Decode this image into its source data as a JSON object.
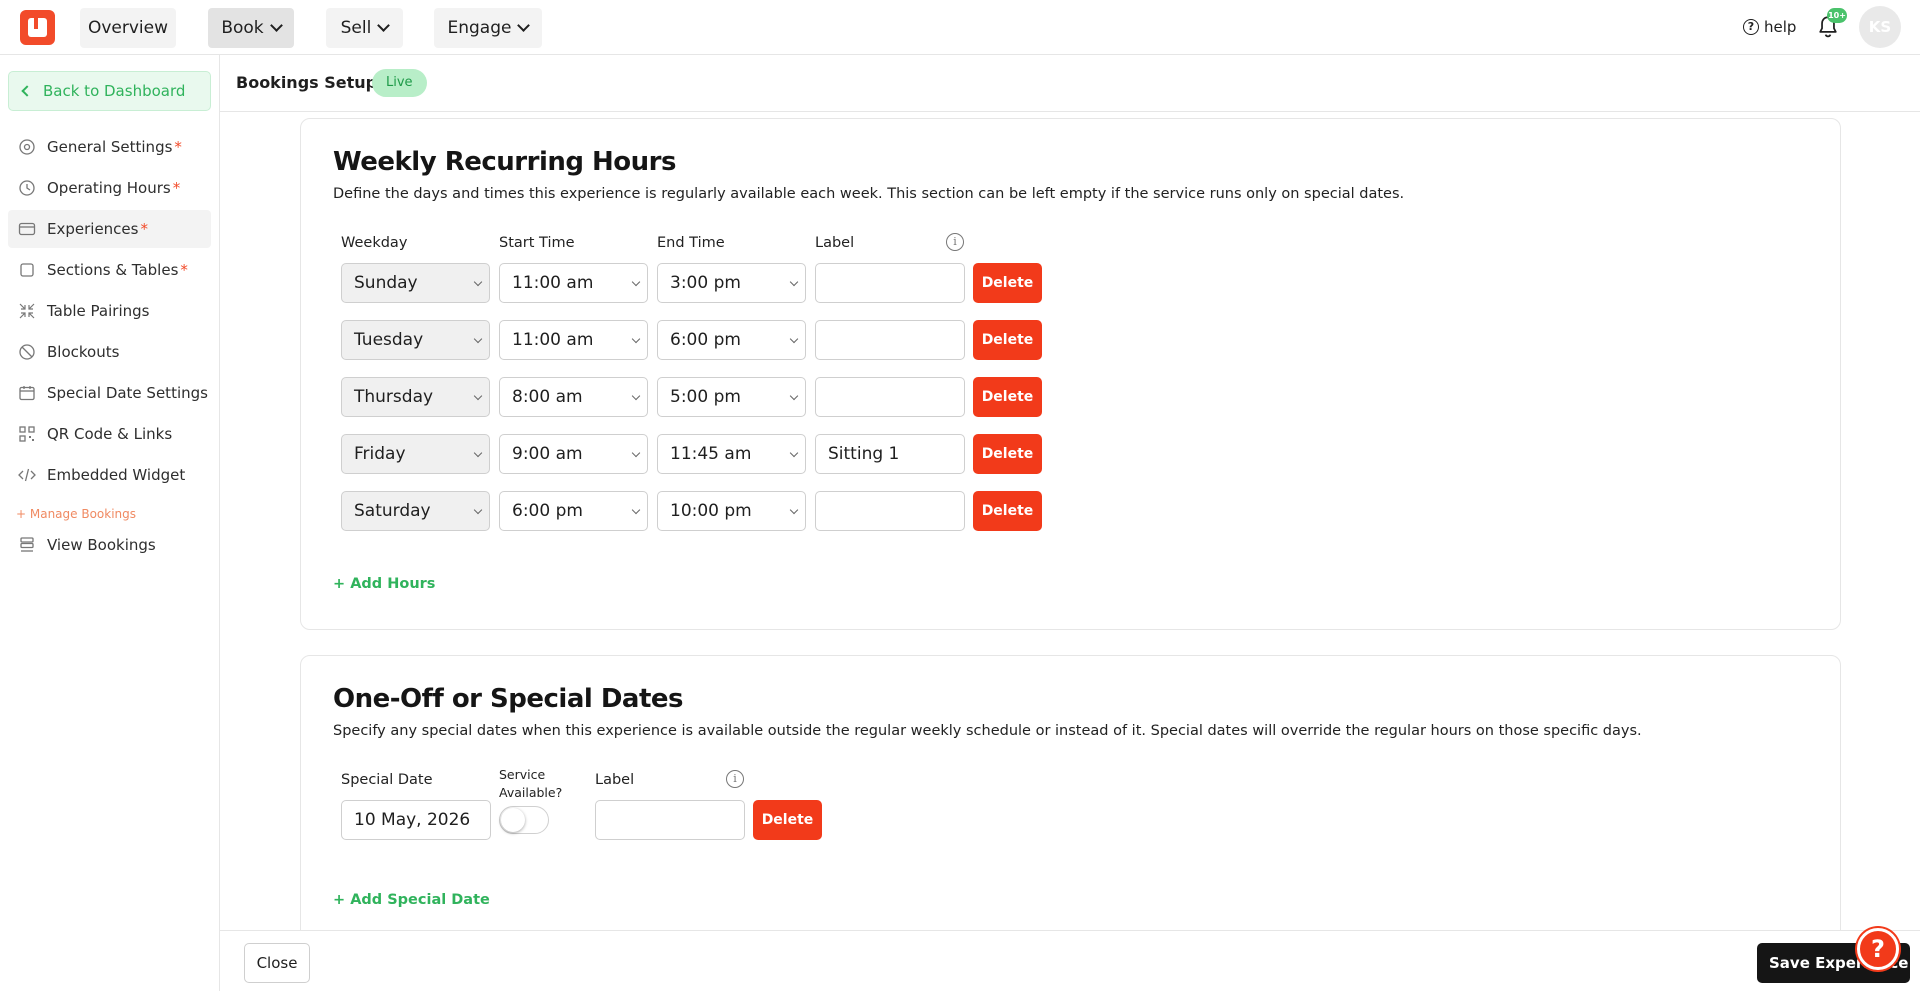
{
  "topnav": {
    "items": [
      {
        "label": "Overview"
      },
      {
        "label": "Book"
      },
      {
        "label": "Sell"
      },
      {
        "label": "Engage"
      }
    ],
    "help_label": "help",
    "notif_badge": "10+",
    "avatar_initials": "KS"
  },
  "sidebar": {
    "back_label": "Back to Dashboard",
    "items": [
      {
        "label": "General Settings",
        "required": "*"
      },
      {
        "label": "Operating Hours",
        "required": "*"
      },
      {
        "label": "Experiences",
        "required": "*"
      },
      {
        "label": "Sections & Tables",
        "required": "*"
      },
      {
        "label": "Table Pairings"
      },
      {
        "label": "Blockouts"
      },
      {
        "label": "Special Date Settings"
      },
      {
        "label": "QR Code & Links"
      },
      {
        "label": "Embedded Widget"
      }
    ],
    "manage_label": "+ Manage Bookings",
    "view_bookings_label": "View Bookings"
  },
  "header": {
    "title": "Bookings Setup",
    "status": "Live"
  },
  "weekly": {
    "title": "Weekly Recurring Hours",
    "description": "Define the days and times this experience is regularly available each week. This section can be left empty if the service runs only on special dates.",
    "columns": {
      "weekday": "Weekday",
      "start": "Start Time",
      "end": "End Time",
      "label": "Label"
    },
    "rows": [
      {
        "weekday": "Sunday",
        "start": "11:00 am",
        "end": "3:00 pm",
        "label": ""
      },
      {
        "weekday": "Tuesday",
        "start": "11:00 am",
        "end": "6:00 pm",
        "label": ""
      },
      {
        "weekday": "Thursday",
        "start": "8:00 am",
        "end": "5:00 pm",
        "label": ""
      },
      {
        "weekday": "Friday",
        "start": "9:00 am",
        "end": "11:45 am",
        "label": "Sitting 1"
      },
      {
        "weekday": "Saturday",
        "start": "6:00 pm",
        "end": "10:00 pm",
        "label": ""
      }
    ],
    "delete_label": "Delete",
    "add_label": "+ Add Hours"
  },
  "special": {
    "title": "One-Off or Special Dates",
    "description": "Specify any special dates when this experience is available outside the regular weekly schedule or instead of it. Special dates will override the regular hours on those specific days.",
    "columns": {
      "date": "Special Date",
      "service_line1": "Service",
      "service_line2": "Available?",
      "label": "Label"
    },
    "rows": [
      {
        "date": "10 May, 2026",
        "service_available": false,
        "label": ""
      }
    ],
    "delete_label": "Delete",
    "add_label": "+ Add Special Date"
  },
  "footer": {
    "close_label": "Close",
    "save_label": "Save Experience"
  },
  "colors": {
    "brand": "#f24b2a",
    "accent_green": "#30b35c",
    "delete_red": "#f23a1a"
  }
}
